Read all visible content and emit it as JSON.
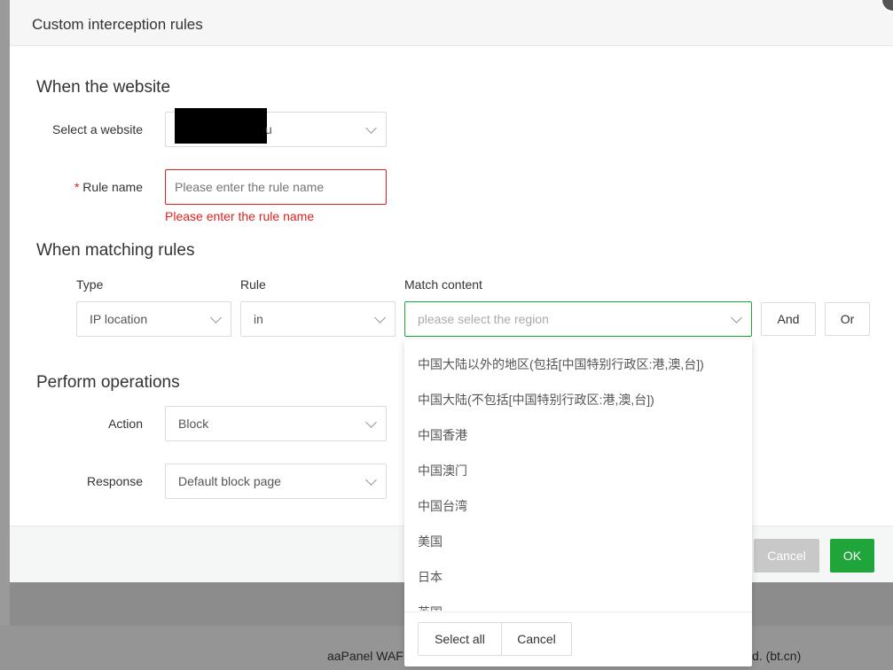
{
  "modal": {
    "title": "Custom interception rules"
  },
  "section_website": {
    "title": "When the website",
    "select_label": "Select a website",
    "select_value": "u",
    "rule_name_required": "*",
    "rule_name_label": "Rule name",
    "rule_name_placeholder": "Please enter the rule name",
    "rule_name_error": "Please enter the rule name"
  },
  "section_match": {
    "title": "When matching rules",
    "type_header": "Type",
    "rule_header": "Rule",
    "content_header": "Match content",
    "type_value": "IP location",
    "rule_value": "in",
    "content_placeholder": "please select the region",
    "and_label": "And",
    "or_label": "Or"
  },
  "section_ops": {
    "title": "Perform operations",
    "action_label": "Action",
    "action_value": "Block",
    "response_label": "Response",
    "response_value": "Default block page"
  },
  "footer": {
    "cancel_label": "Cancel",
    "ok_label": "OK"
  },
  "dropdown": {
    "options": [
      "中国大陆以外的地区(包括[中国特别行政区:港,澳,台])",
      "中国大陆(不包括[中国特别行政区:港,澳,台])",
      "中国香港",
      "中国澳门",
      "中国台湾",
      "美国",
      "日本",
      "英国"
    ],
    "select_all_label": "Select all",
    "cancel_label": "Cancel"
  },
  "page_footer": {
    "left_text": "aaPanel WAF",
    "right_text": "d. (bt.cn)"
  },
  "colors": {
    "ok": "#20a53a",
    "error": "#e02020",
    "focus": "#20a53a"
  }
}
